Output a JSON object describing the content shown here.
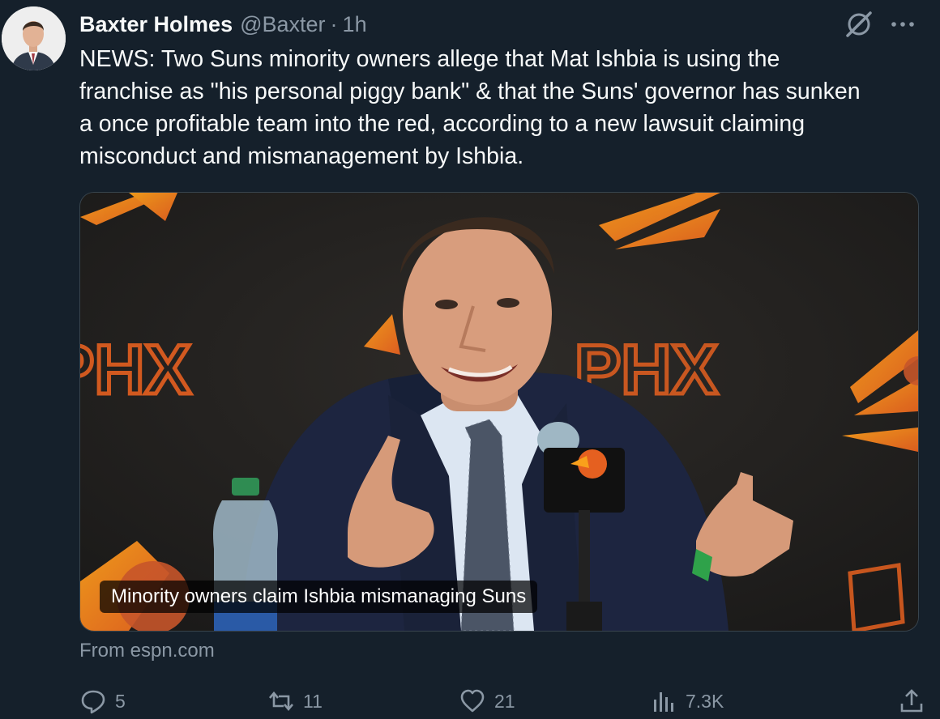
{
  "author": {
    "name": "Baxter Holmes",
    "handle": "@Baxter",
    "separator": "·",
    "time": "1h"
  },
  "tweet": {
    "text": "NEWS: Two Suns minority owners allege that Mat Ishbia is using the\nfranchise as \"his personal piggy bank\" & that the Suns' governor has sunken\na once profitable team into the red, according to a new lawsuit claiming\nmisconduct and mismanagement by Ishbia."
  },
  "card": {
    "headline": "Minority owners claim Ishbia mismanaging Suns",
    "source": "From espn.com",
    "backdrop_text": "PHX"
  },
  "actions": {
    "replies": "5",
    "reposts": "11",
    "likes": "21",
    "views": "7.3K"
  },
  "icons": {
    "grok": "grok-icon",
    "more": "more-icon",
    "reply": "reply-icon",
    "repost": "repost-icon",
    "like": "like-icon",
    "views": "views-icon",
    "share": "share-icon"
  },
  "colors": {
    "background": "#15202b",
    "text": "#f7f9f9",
    "secondary": "#8b98a5",
    "border": "#38444d",
    "suns_orange": "#e56020",
    "suns_yellow": "#f9a01b"
  }
}
